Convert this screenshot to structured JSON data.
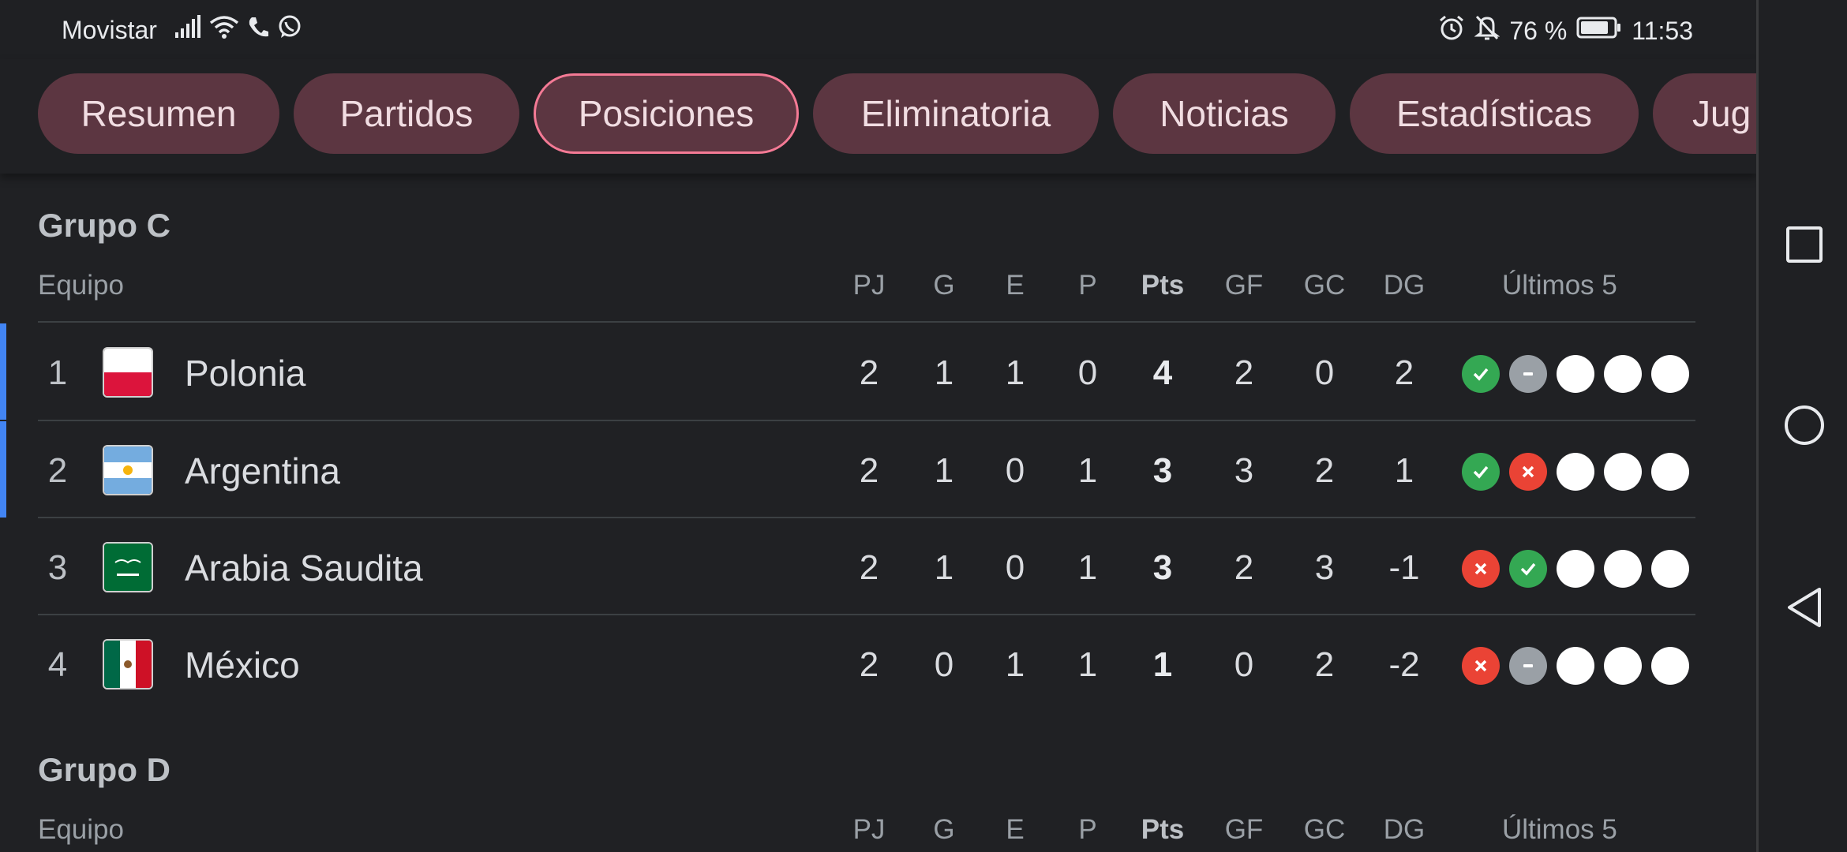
{
  "status_bar": {
    "carrier": "Movistar",
    "battery_percent": "76 %",
    "time": "11:53"
  },
  "tabs": [
    "Resumen",
    "Partidos",
    "Posiciones",
    "Eliminatoria",
    "Noticias",
    "Estadísticas",
    "Jug"
  ],
  "active_tab": "Posiciones",
  "columns": [
    "PJ",
    "G",
    "E",
    "P",
    "Pts",
    "GF",
    "GC",
    "DG",
    "Últimos 5"
  ],
  "team_header": "Equipo",
  "groups": [
    {
      "title": "Grupo C",
      "rows": [
        {
          "rank": "1",
          "team": "Polonia",
          "flag": "poland",
          "pj": "2",
          "g": "1",
          "e": "1",
          "p": "0",
          "pts": "4",
          "gf": "2",
          "gc": "0",
          "dg": "2",
          "form": [
            "win",
            "draw",
            "none",
            "none",
            "none"
          ],
          "qualified": true
        },
        {
          "rank": "2",
          "team": "Argentina",
          "flag": "argentina",
          "pj": "2",
          "g": "1",
          "e": "0",
          "p": "1",
          "pts": "3",
          "gf": "3",
          "gc": "2",
          "dg": "1",
          "form": [
            "win",
            "loss",
            "none",
            "none",
            "none"
          ],
          "qualified": true
        },
        {
          "rank": "3",
          "team": "Arabia Saudita",
          "flag": "saudi-arabia",
          "pj": "2",
          "g": "1",
          "e": "0",
          "p": "1",
          "pts": "3",
          "gf": "2",
          "gc": "3",
          "dg": "-1",
          "form": [
            "loss",
            "win",
            "none",
            "none",
            "none"
          ],
          "qualified": false
        },
        {
          "rank": "4",
          "team": "México",
          "flag": "mexico",
          "pj": "2",
          "g": "0",
          "e": "1",
          "p": "1",
          "pts": "1",
          "gf": "0",
          "gc": "2",
          "dg": "-2",
          "form": [
            "loss",
            "draw",
            "none",
            "none",
            "none"
          ],
          "qualified": false
        }
      ]
    },
    {
      "title": "Grupo D",
      "rows": []
    }
  ],
  "colors": {
    "background": "#202124",
    "chip": "#5c3641",
    "chip_active_border": "#f47a95",
    "win": "#34a853",
    "loss": "#ea4335",
    "draw": "#9aa0a6",
    "qualified_marker": "#4285f4"
  },
  "icons": {
    "status_left": [
      "signal-icon",
      "wifi-icon",
      "phone-call-icon",
      "whatsapp-icon"
    ],
    "status_right": [
      "alarm-icon",
      "notifications-off-icon",
      "battery-icon"
    ],
    "nav": [
      "recents-square-icon",
      "home-circle-icon",
      "back-triangle-icon"
    ]
  }
}
